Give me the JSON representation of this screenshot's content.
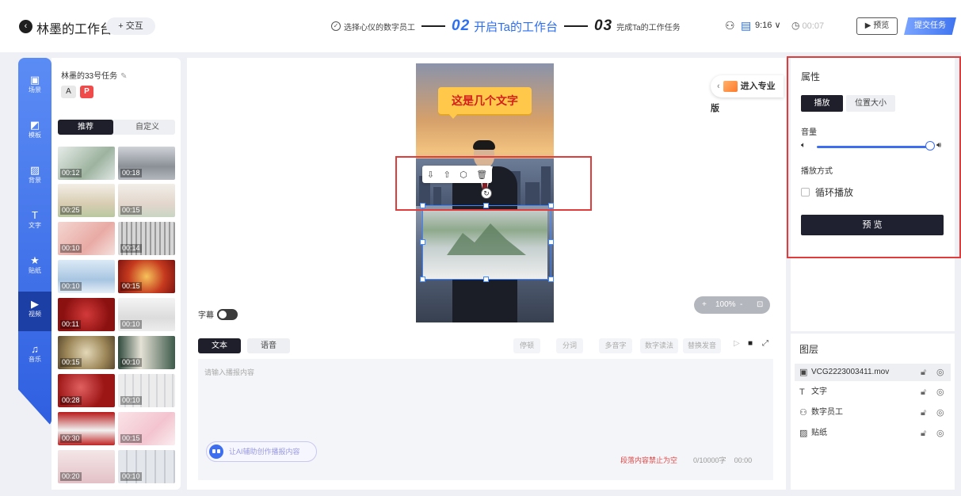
{
  "header": {
    "back_icon": "chevron-left-icon",
    "workspace_title": "林墨的工作台",
    "interact_label": "+ 交互",
    "steps": {
      "step1_label": "选择心仪的数字员工",
      "step2_num": "02",
      "step2_label": "开启Ta的工作台",
      "step3_num": "03",
      "step3_label": "完成Ta的工作任务"
    },
    "ratio": "9:16 ∨",
    "timer": "00:07",
    "preview_label": "预览",
    "submit_label": "提交任务",
    "accent_color": "#2d6ff0"
  },
  "rail": {
    "items": [
      {
        "label": "场景",
        "icon": "scene-icon"
      },
      {
        "label": "模板",
        "icon": "template-icon"
      },
      {
        "label": "背景",
        "icon": "image-icon"
      },
      {
        "label": "文字",
        "icon": "text-icon"
      },
      {
        "label": "贴纸",
        "icon": "star-icon"
      },
      {
        "label": "视频",
        "icon": "video-icon"
      },
      {
        "label": "音乐",
        "icon": "music-icon"
      }
    ],
    "active": "视频"
  },
  "material_panel": {
    "task_name": "林墨的33号任务",
    "tags": [
      "A",
      "P"
    ],
    "tabs": [
      "推荐",
      "自定义"
    ],
    "active_tab": "推荐",
    "durations": [
      "00:12",
      "00:18",
      "00:25",
      "00:15",
      "00:10",
      "00:14",
      "00:10",
      "00:15",
      "00:11",
      "00:10",
      "00:15",
      "00:10",
      "00:28",
      "00:10",
      "00:30",
      "00:15",
      "00:20",
      "00:10"
    ]
  },
  "canvas": {
    "banner_text": "这是几个文字",
    "pro_label": "进入专业版",
    "subtitle_label": "字幕",
    "zoom": "100%",
    "zoom_minus": "-",
    "zoom_plus": "+"
  },
  "editor": {
    "tabs": [
      "文本",
      "语音"
    ],
    "active_tab": "文本",
    "tools": [
      "停顿",
      "分词",
      "多音字",
      "数字读法",
      "替换发音"
    ],
    "placeholder": "请输入播报内容",
    "ai_label": "让AI辅助创作播报内容",
    "warning": "段落内容禁止为空",
    "char_count": "0/10000字",
    "duration": "00:00"
  },
  "properties": {
    "title": "属性",
    "tabs": [
      "播放",
      "位置大小"
    ],
    "active_tab": "播放",
    "volume_label": "音量",
    "volume_level": 1.0,
    "mode_label": "播放方式",
    "loop_label": "循环播放",
    "loop_checked": false,
    "preview_label": "预 览"
  },
  "layers": {
    "title": "图层",
    "items": [
      {
        "icon": "video-icon",
        "name": "VCG2223003411.mov"
      },
      {
        "icon": "text-icon",
        "name": "文字"
      },
      {
        "icon": "person-icon",
        "name": "数字员工"
      },
      {
        "icon": "image-icon",
        "name": "贴纸"
      }
    ]
  }
}
